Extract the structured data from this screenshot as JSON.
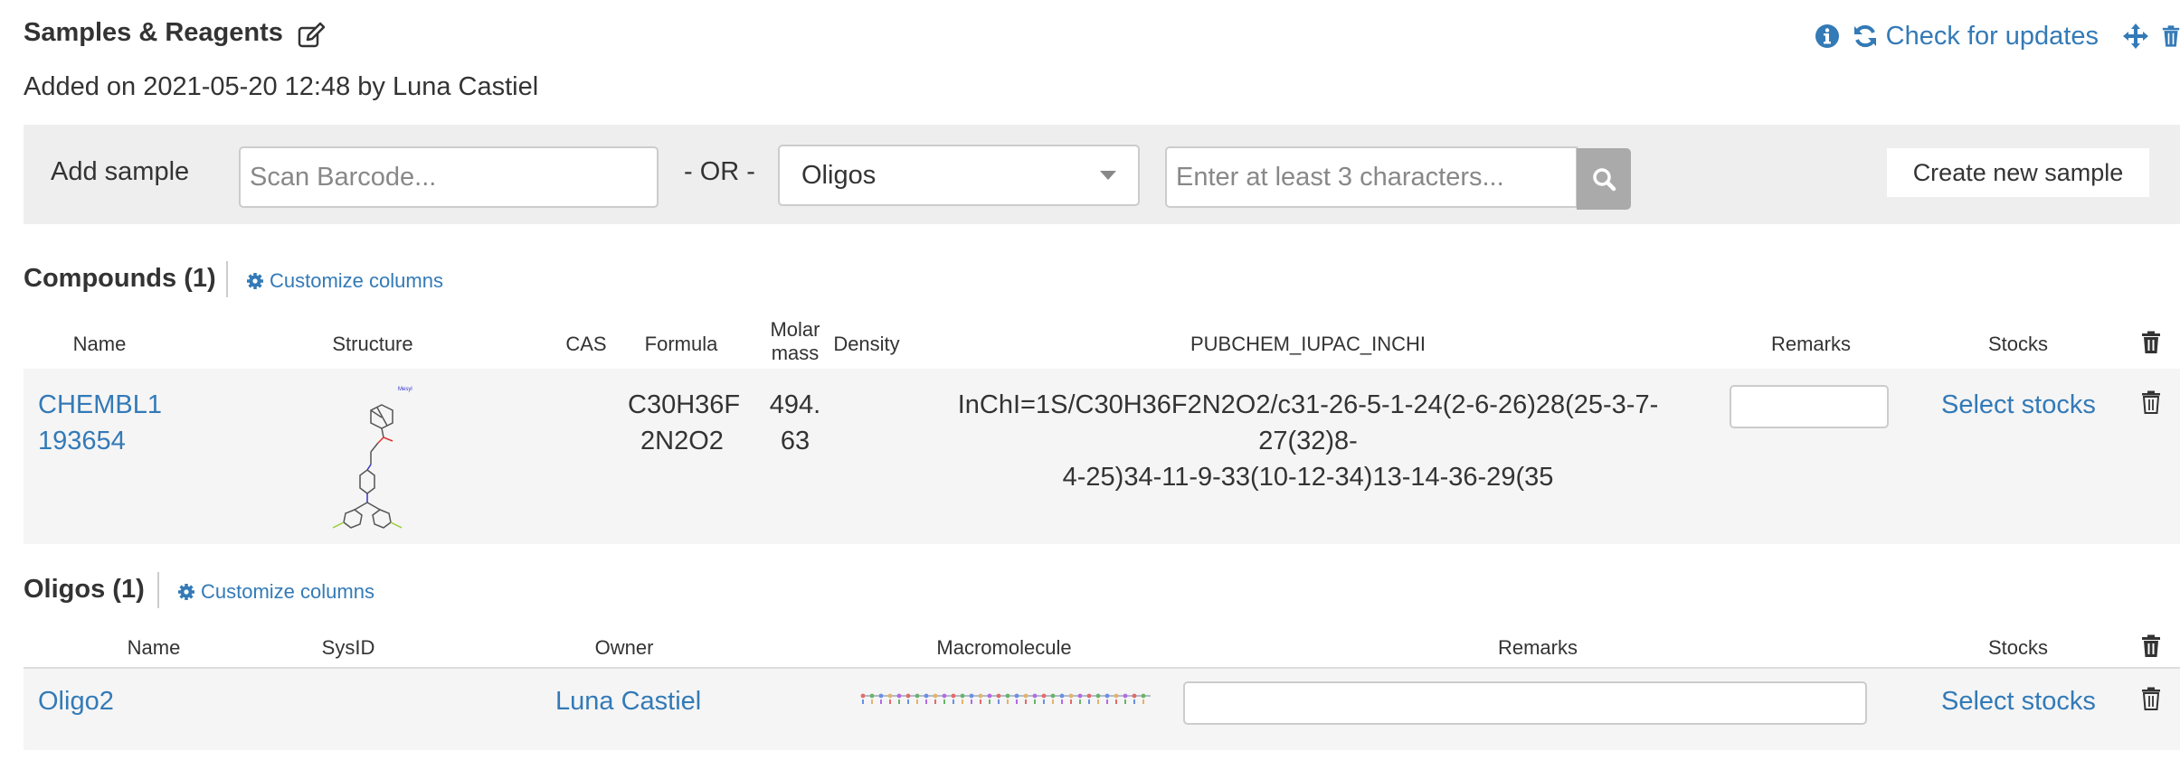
{
  "header": {
    "title": "Samples & Reagents",
    "added": "Added on 2021-05-20 12:48 by Luna Castiel",
    "check_updates": "Check for updates"
  },
  "add_bar": {
    "label": "Add sample",
    "barcode_placeholder": "Scan Barcode...",
    "or": "- OR -",
    "type_selected": "Oligos",
    "search_placeholder": "Enter at least 3 characters...",
    "create_label": "Create new sample"
  },
  "compounds": {
    "title": "Compounds (1)",
    "customize": "Customize columns",
    "columns": {
      "name": "Name",
      "structure": "Structure",
      "cas": "CAS",
      "formula": "Formula",
      "molar_mass_1": "Molar",
      "molar_mass_2": "mass",
      "density": "Density",
      "inchi": "PUBCHEM_IUPAC_INCHI",
      "remarks": "Remarks",
      "stocks": "Stocks"
    },
    "rows": [
      {
        "name_1": "CHEMBL1",
        "name_2": "193654",
        "formula_1": "C30H36F",
        "formula_2": "2N2O2",
        "mass_1": "494.",
        "mass_2": "63",
        "inchi_1": "InChI=1S/C30H36F2N2O2/c31-26-5-1-24(2-6-26)28(25-3-7-27(32)8-",
        "inchi_2": "4-25)34-11-9-33(10-12-34)13-14-36-29(35",
        "remarks": "",
        "stocks": "Select stocks"
      }
    ]
  },
  "oligos": {
    "title": "Oligos (1)",
    "customize": "Customize columns",
    "columns": {
      "name": "Name",
      "sysid": "SysID",
      "owner": "Owner",
      "macromolecule": "Macromolecule",
      "remarks": "Remarks",
      "stocks": "Stocks"
    },
    "rows": [
      {
        "name": "Oligo2",
        "sysid": "",
        "owner": "Luna Castiel",
        "remarks": "",
        "stocks": "Select stocks"
      }
    ]
  },
  "icons": {
    "edit": "edit-icon",
    "info": "info-icon",
    "refresh": "refresh-icon",
    "move": "move-icon",
    "trash": "trash-icon",
    "search": "search-icon",
    "gear": "gear-icon"
  },
  "colors": {
    "link": "#337ab7",
    "bar_bg": "#eeeeee",
    "row_bg": "#f5f5f5"
  }
}
